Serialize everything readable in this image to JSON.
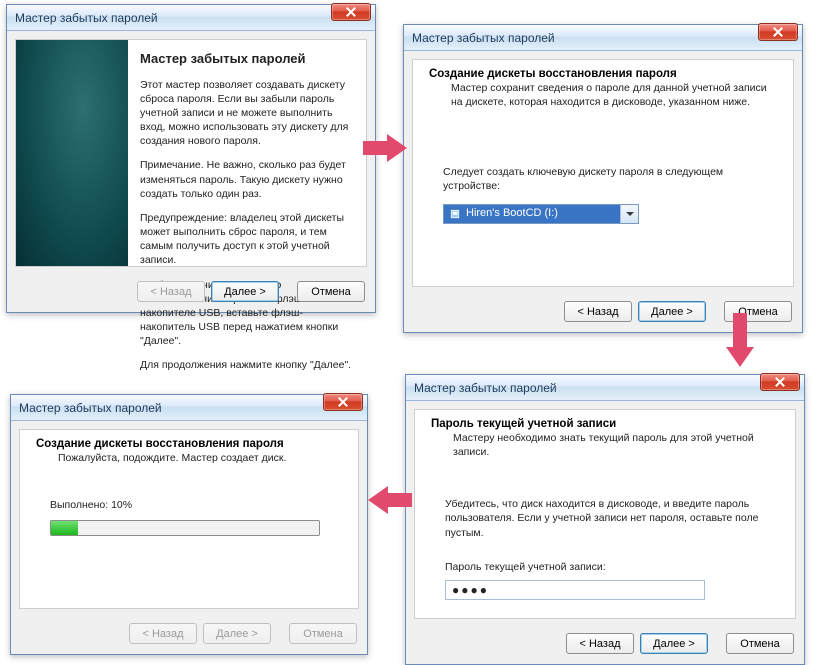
{
  "buttons": {
    "back": "< Назад",
    "next": "Далее >",
    "cancel": "Отмена"
  },
  "w1": {
    "title": "Мастер забытых паролей",
    "heading": "Мастер забытых паролей",
    "p1": "Этот мастер позволяет создавать дискету сброса пароля. Если вы забыли пароль учетной записи и не можете выполнить вход, можно использовать эту дискету для создания нового пароля.",
    "p2": "Примечание. Не важно, сколько раз будет изменяться пароль. Такую дискету нужно создать только один раз.",
    "p3": "Предупреждение: владелец этой дискеты может выполнить сброс пароля, и тем самым получить доступ к этой учетной записи.",
    "p4": "Чтобы сохранить сведения о восстановлении пароля на флэш-накопителе USB, вставьте флэш-накопитель USB перед нажатием кнопки \"Далее\".",
    "p5": "Для продолжения нажмите кнопку \"Далее\"."
  },
  "w2": {
    "title": "Мастер забытых паролей",
    "ph_title": "Создание дискеты восстановления пароля",
    "ph_sub": "Мастер сохранит сведения о пароле для данной учетной записи на дискете, которая находится в дисководе, указанном ниже.",
    "body_text": "Следует создать ключевую дискету пароля в следующем устройстве:",
    "dd_value": "Hiren's BootCD (I:)"
  },
  "w3": {
    "title": "Мастер забытых паролей",
    "ph_title": "Пароль текущей учетной записи",
    "ph_sub": "Мастеру необходимо знать текущий пароль для этой учетной записи.",
    "body1": "Убедитесь, что диск находится в дисководе, и введите пароль пользователя. Если у учетной записи нет пароля, оставьте поле пустым.",
    "label": "Пароль текущей учетной записи:",
    "value": "●●●●"
  },
  "w4": {
    "title": "Мастер забытых паролей",
    "ph_title": "Создание дискеты восстановления пароля",
    "ph_sub": "Пожалуйста, подождите. Мастер создает диск.",
    "progress_label": "Выполнено: 10%",
    "progress_pct": 10
  }
}
